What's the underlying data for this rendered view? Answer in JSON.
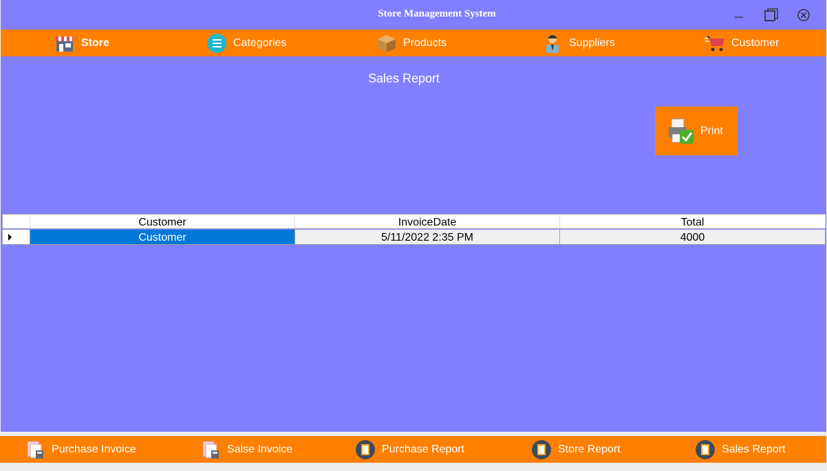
{
  "window": {
    "title": "Store Management System"
  },
  "topnav": {
    "items": [
      {
        "label": "Store",
        "icon": "store-icon"
      },
      {
        "label": "Categories",
        "icon": "list-icon"
      },
      {
        "label": "Products",
        "icon": "box-icon"
      },
      {
        "label": "Suppliers",
        "icon": "person-icon"
      },
      {
        "label": "Customer",
        "icon": "cart-icon"
      }
    ]
  },
  "main": {
    "report_title": "Sales Report",
    "print_label": "Print"
  },
  "grid": {
    "columns": [
      "Customer",
      "InvoiceDate",
      "Total"
    ],
    "rows": [
      {
        "customer": "Customer",
        "invoice_date": "5/11/2022 2:35 PM",
        "total": "4000"
      }
    ]
  },
  "bottomnav": {
    "items": [
      {
        "label": "Purchase Invoice",
        "icon": "invoice-icon"
      },
      {
        "label": "Salse Invoice",
        "icon": "invoice-icon"
      },
      {
        "label": "Purchase Report",
        "icon": "report-icon"
      },
      {
        "label": "Store Report",
        "icon": "report-icon"
      },
      {
        "label": "Sales Report",
        "icon": "report-icon"
      }
    ]
  },
  "colors": {
    "background": "#8080ff",
    "accent": "#ff8000",
    "selection": "#0078d7"
  }
}
